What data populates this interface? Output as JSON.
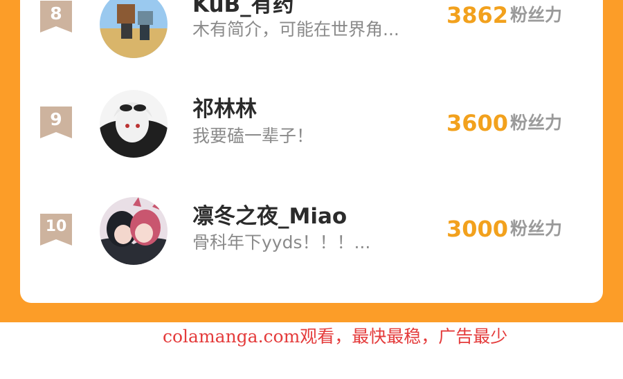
{
  "ranking": {
    "score_unit": "粉丝力",
    "rows": [
      {
        "rank": "8",
        "name": "KuB_有药",
        "bio": "木有简介，可能在世界角...",
        "score": "3862"
      },
      {
        "rank": "9",
        "name": "祁林林",
        "bio": "我要磕一辈子！",
        "score": "3600"
      },
      {
        "rank": "10",
        "name": "凛冬之夜_Miao",
        "bio": "骨科年下yyds！！！...",
        "score": "3000"
      }
    ]
  },
  "watermark": {
    "text": "colamanga.com观看，最快最稳，广告最少"
  },
  "colors": {
    "background_orange": "#fc9d28",
    "score": "#f2a11d",
    "watermark": "#e43b3b",
    "badge": "#cdb39e"
  }
}
